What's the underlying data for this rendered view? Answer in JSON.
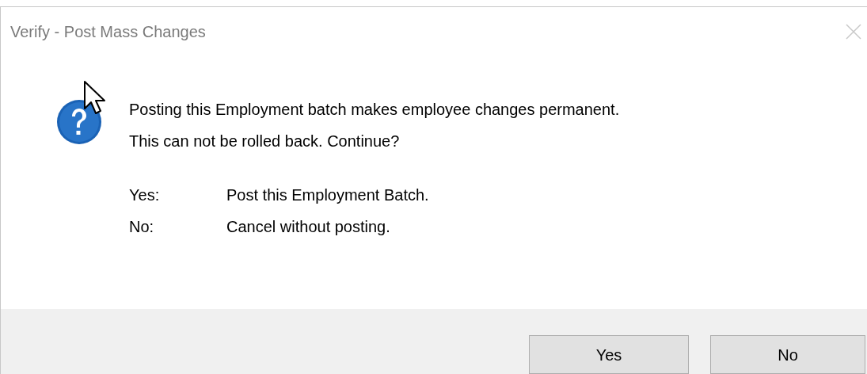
{
  "window": {
    "title": "Verify - Post Mass Changes"
  },
  "message_lines": [
    "Posting this Employment batch makes employee changes permanent.",
    "This can not be rolled back. Continue?"
  ],
  "options": [
    {
      "key": "Yes:",
      "description": "Post this Employment Batch."
    },
    {
      "key": "No:",
      "description": "Cancel without posting."
    }
  ],
  "buttons": [
    {
      "label": "Yes"
    },
    {
      "label": "No"
    }
  ]
}
